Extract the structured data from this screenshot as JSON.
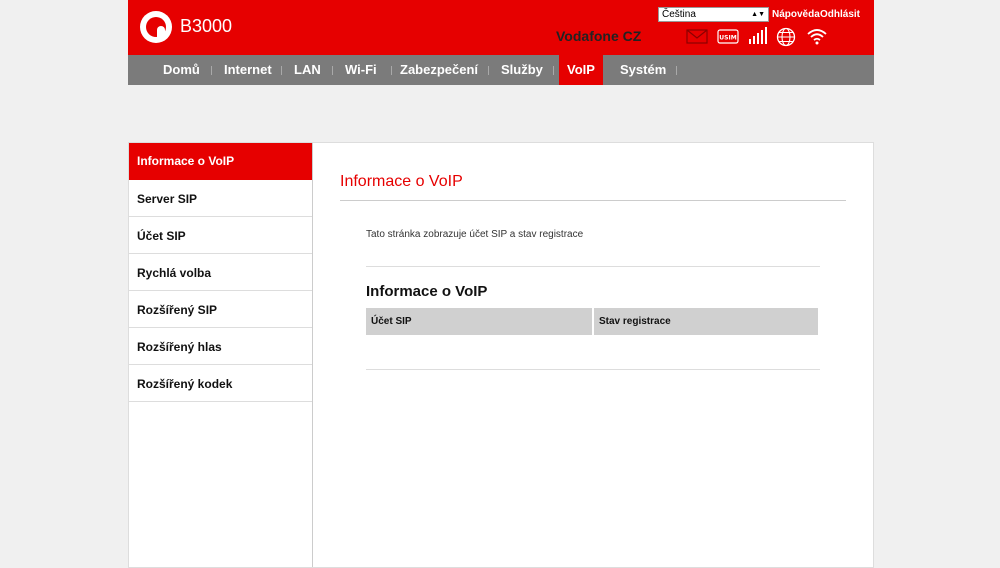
{
  "header": {
    "product_name": "B3000",
    "language": "Čeština",
    "help_label": "Nápověda",
    "logout_label": "Odhlásit",
    "operator": "Vodafone CZ",
    "status_icons": [
      "envelope-icon",
      "usim-icon",
      "signal-bars-icon",
      "globe-icon",
      "wifi-icon"
    ],
    "brand_color": "#e60000"
  },
  "nav": {
    "items": [
      {
        "label": "Domů"
      },
      {
        "label": "Internet"
      },
      {
        "label": "LAN"
      },
      {
        "label": "Wi-Fi"
      },
      {
        "label": "Zabezpečení"
      },
      {
        "label": "Služby"
      },
      {
        "label": "VoIP",
        "active": true
      },
      {
        "label": "Systém"
      }
    ]
  },
  "sidebar": {
    "items": [
      {
        "label": "Informace o VoIP",
        "active": true
      },
      {
        "label": "Server SIP"
      },
      {
        "label": "Účet SIP"
      },
      {
        "label": "Rychlá volba"
      },
      {
        "label": "Rozšířený SIP"
      },
      {
        "label": "Rozšířený hlas"
      },
      {
        "label": "Rozšířený kodek"
      }
    ]
  },
  "main": {
    "title": "Informace o VoIP",
    "description": "Tato stránka zobrazuje účet SIP a stav registrace",
    "section_title": "Informace o VoIP",
    "table": {
      "columns": [
        "Účet SIP",
        "Stav registrace"
      ],
      "rows": []
    }
  }
}
